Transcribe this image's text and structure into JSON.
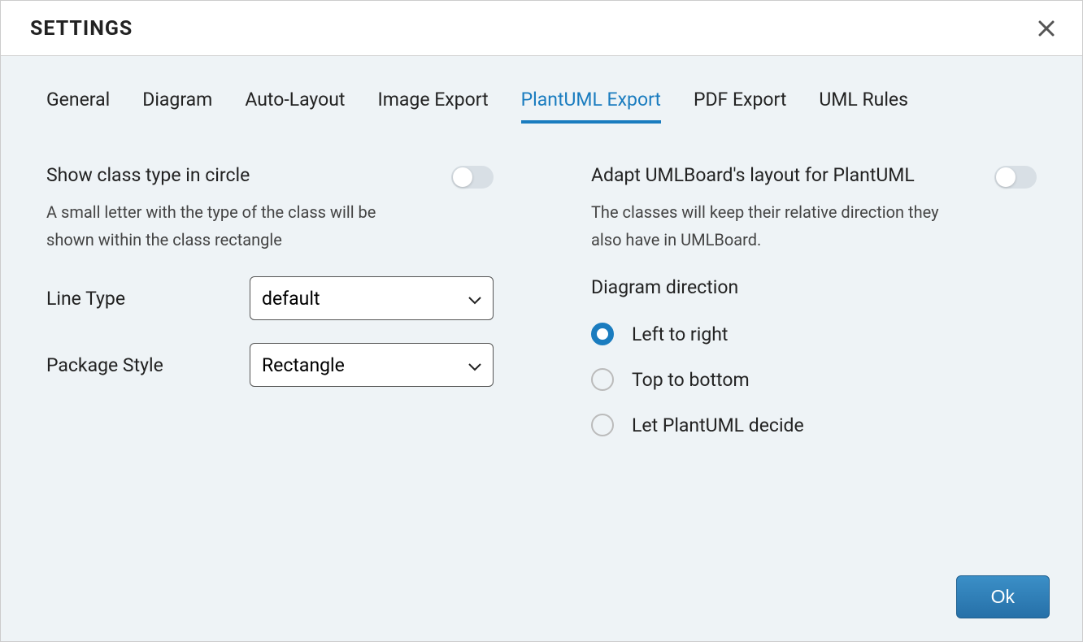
{
  "dialog": {
    "title": "SETTINGS",
    "ok_label": "Ok"
  },
  "tabs": {
    "items": [
      {
        "label": "General",
        "active": false
      },
      {
        "label": "Diagram",
        "active": false
      },
      {
        "label": "Auto-Layout",
        "active": false
      },
      {
        "label": "Image Export",
        "active": false
      },
      {
        "label": "PlantUML Export",
        "active": true
      },
      {
        "label": "PDF Export",
        "active": false
      },
      {
        "label": "UML Rules",
        "active": false
      }
    ]
  },
  "left": {
    "show_class_type": {
      "label": "Show class type in circle",
      "desc": "A small letter with the type of the class will be shown within the class rectangle",
      "value": false
    },
    "line_type": {
      "label": "Line Type",
      "value": "default"
    },
    "package_style": {
      "label": "Package Style",
      "value": "Rectangle"
    }
  },
  "right": {
    "adapt_layout": {
      "label": "Adapt UMLBoard's layout for PlantUML",
      "desc": "The classes will keep their relative direction they also have in UMLBoard.",
      "value": false
    },
    "direction": {
      "label": "Diagram direction",
      "options": [
        {
          "label": "Left to right",
          "selected": true
        },
        {
          "label": "Top to bottom",
          "selected": false
        },
        {
          "label": "Let PlantUML decide",
          "selected": false
        }
      ]
    }
  }
}
